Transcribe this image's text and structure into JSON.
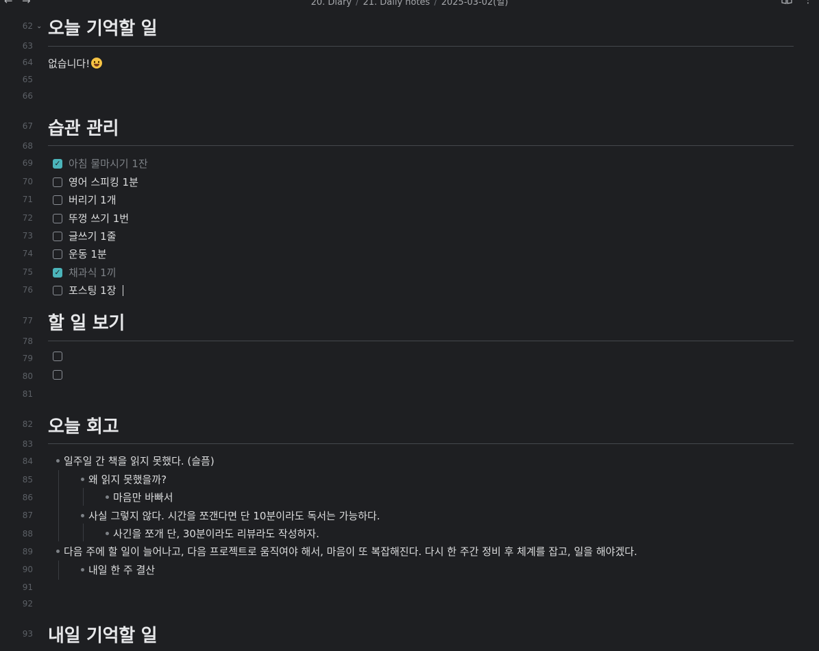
{
  "topbar": {
    "back_icon": "arrow-left-icon",
    "forward_icon": "arrow-right-icon",
    "breadcrumb": [
      "20. Diary",
      "21. Daily notes",
      "2025-03-02(일)"
    ],
    "separator": "/",
    "reading_view_icon": "book-open-icon",
    "more_icon": "more-vertical-icon"
  },
  "line_numbers": {
    "l62": "62",
    "l63": "63",
    "l64": "64",
    "l65": "65",
    "l66": "66",
    "l67": "67",
    "l68": "68",
    "l69": "69",
    "l70": "70",
    "l71": "71",
    "l72": "72",
    "l73": "73",
    "l74": "74",
    "l75": "75",
    "l76": "76",
    "l77": "77",
    "l78": "78",
    "l79": "79",
    "l80": "80",
    "l81": "81",
    "l82": "82",
    "l83": "83",
    "l84": "84",
    "l85": "85",
    "l86": "86",
    "l87": "87",
    "l88": "88",
    "l89": "89",
    "l90": "90",
    "l91": "91",
    "l92": "92",
    "l93": "93"
  },
  "sections": {
    "remember_today": {
      "heading": "오늘 기억할 일",
      "body": "없습니다!"
    },
    "habits": {
      "heading": "습관 관리",
      "tasks": [
        {
          "label": "아침 물마시기 1잔",
          "checked": true
        },
        {
          "label": "영어 스피킹 1분",
          "checked": false
        },
        {
          "label": "버리기 1개",
          "checked": false
        },
        {
          "label": "뚜껑 쓰기 1번",
          "checked": false
        },
        {
          "label": "글쓰기 1줄",
          "checked": false
        },
        {
          "label": "운동 1분",
          "checked": false
        },
        {
          "label": "채과식 1끼",
          "checked": true
        },
        {
          "label": "포스팅 1장",
          "checked": false
        }
      ]
    },
    "todo": {
      "heading": "할 일 보기",
      "tasks": [
        {
          "label": "",
          "checked": false
        },
        {
          "label": "",
          "checked": false
        }
      ]
    },
    "retro": {
      "heading": "오늘 회고",
      "bullets": [
        "일주일 간 책을 읽지 못했다. (슬픔)",
        "왜 읽지 못했을까?",
        "마음만 바빠서",
        "사실 그렇지 않다. 시간을 쪼갠다면 단 10분이라도 독서는 가능하다.",
        "사긴을 쪼개 단, 30분이라도 리뷰라도 작성하자.",
        "다음 주에 할 일이 늘어나고, 다음 프로젝트로 움직여야 해서, 마음이 또 복잡해진다. 다시 한 주간 정비 후 체계를 잡고, 일을 해야겠다.",
        "내일 한 주 결산"
      ]
    },
    "remember_tomorrow": {
      "heading": "내일 기억할 일"
    }
  },
  "colors": {
    "background": "#1e1f22",
    "checkbox_checked": "#4bb4ba",
    "text": "#dcddde",
    "muted": "#7d8186"
  }
}
